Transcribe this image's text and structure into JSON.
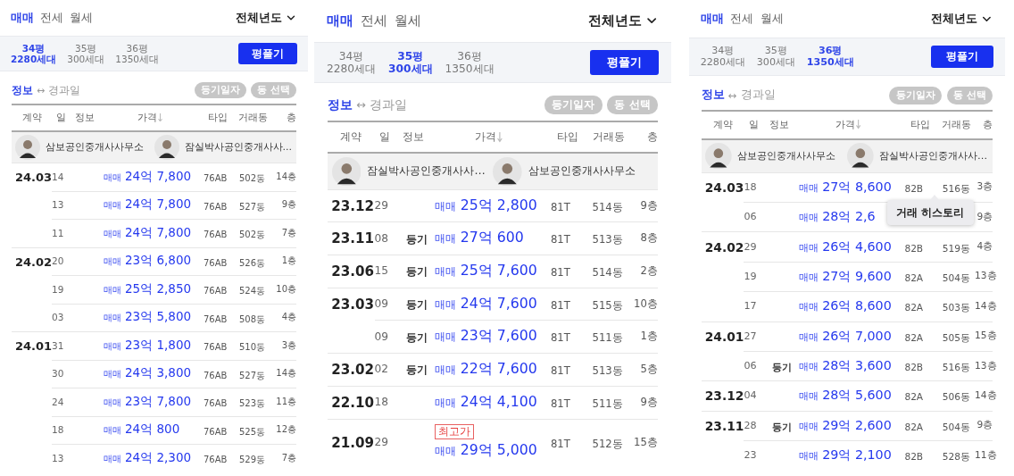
{
  "panels": [
    {
      "deal_tabs": [
        {
          "label": "매매",
          "selected": true
        },
        {
          "label": "전세",
          "selected": false
        },
        {
          "label": "월세",
          "selected": false
        }
      ],
      "year_filter": "전체년도",
      "sizes": [
        {
          "area": "34평",
          "units": "2280세대",
          "selected": true
        },
        {
          "area": "35평",
          "units": "300세대",
          "selected": false
        },
        {
          "area": "36평",
          "units": "1350세대",
          "selected": false
        }
      ],
      "size_button": "평풀기",
      "toggle": [
        {
          "label": "정보",
          "selected": true
        },
        {
          "label": "경과일",
          "selected": false
        }
      ],
      "toggle_separator": "↔",
      "chips": [
        "등기일자",
        "동 선택"
      ],
      "columns": [
        "계약",
        "일",
        "정보",
        "가격",
        "타입",
        "거래동",
        "층"
      ],
      "agents": [
        {
          "name": "삼보공인중개사사무소"
        },
        {
          "name": "잠실박사공인중개사사…"
        }
      ],
      "rows": [
        {
          "month": "24.03",
          "day": "14",
          "deal": "매매",
          "price": "24억 7,800",
          "type": "76AB",
          "dong": "502동",
          "floor": "14층"
        },
        {
          "day": "13",
          "deal": "매매",
          "price": "24억 7,800",
          "type": "76AB",
          "dong": "527동",
          "floor": "9층"
        },
        {
          "day": "11",
          "deal": "매매",
          "price": "24억 7,800",
          "type": "76AB",
          "dong": "502동",
          "floor": "7층"
        },
        {
          "month": "24.02",
          "day": "20",
          "deal": "매매",
          "price": "23억 6,800",
          "type": "76AB",
          "dong": "526동",
          "floor": "1층"
        },
        {
          "day": "19",
          "deal": "매매",
          "price": "25억 2,850",
          "type": "76AB",
          "dong": "524동",
          "floor": "10층"
        },
        {
          "day": "03",
          "deal": "매매",
          "price": "23억 5,800",
          "type": "76AB",
          "dong": "508동",
          "floor": "4층"
        },
        {
          "month": "24.01",
          "day": "31",
          "deal": "매매",
          "price": "23억 1,800",
          "type": "76AB",
          "dong": "510동",
          "floor": "3층"
        },
        {
          "day": "30",
          "deal": "매매",
          "price": "24억 3,800",
          "type": "76AB",
          "dong": "527동",
          "floor": "14층"
        },
        {
          "day": "24",
          "deal": "매매",
          "price": "23억 7,800",
          "type": "76AB",
          "dong": "523동",
          "floor": "11층"
        },
        {
          "day": "18",
          "deal": "매매",
          "price": "24억 800",
          "type": "76AB",
          "dong": "525동",
          "floor": "12층"
        },
        {
          "day": "13",
          "deal": "매매",
          "price": "24억 2,300",
          "type": "76AB",
          "dong": "529동",
          "floor": "7층"
        }
      ]
    },
    {
      "deal_tabs": [
        {
          "label": "매매",
          "selected": true
        },
        {
          "label": "전세",
          "selected": false
        },
        {
          "label": "월세",
          "selected": false
        }
      ],
      "year_filter": "전체년도",
      "sizes": [
        {
          "area": "34평",
          "units": "2280세대",
          "selected": false
        },
        {
          "area": "35평",
          "units": "300세대",
          "selected": true
        },
        {
          "area": "36평",
          "units": "1350세대",
          "selected": false
        }
      ],
      "size_button": "평풀기",
      "toggle": [
        {
          "label": "정보",
          "selected": true
        },
        {
          "label": "경과일",
          "selected": false
        }
      ],
      "toggle_separator": "↔",
      "chips": [
        "등기일자",
        "동 선택"
      ],
      "columns": [
        "계약",
        "일",
        "정보",
        "가격",
        "타입",
        "거래동",
        "층"
      ],
      "agents": [
        {
          "name": "잠실박사공인중개사사…"
        },
        {
          "name": "삼보공인중개사사무소"
        }
      ],
      "rows": [
        {
          "month": "23.12",
          "day": "29",
          "deal": "매매",
          "price": "25억 2,800",
          "type": "81T",
          "dong": "514동",
          "floor": "9층"
        },
        {
          "month": "23.11",
          "day": "08",
          "info": "등기",
          "deal": "매매",
          "price": "27억 600",
          "type": "81T",
          "dong": "513동",
          "floor": "8층"
        },
        {
          "month": "23.06",
          "day": "15",
          "info": "등기",
          "deal": "매매",
          "price": "25억 7,600",
          "type": "81T",
          "dong": "514동",
          "floor": "2층"
        },
        {
          "month": "23.03",
          "day": "09",
          "info": "등기",
          "deal": "매매",
          "price": "24억 7,600",
          "type": "81T",
          "dong": "515동",
          "floor": "10층"
        },
        {
          "day": "09",
          "info": "등기",
          "deal": "매매",
          "price": "23억 7,600",
          "type": "81T",
          "dong": "511동",
          "floor": "1층"
        },
        {
          "month": "23.02",
          "day": "02",
          "info": "등기",
          "deal": "매매",
          "price": "22억 7,600",
          "type": "81T",
          "dong": "513동",
          "floor": "5층"
        },
        {
          "month": "22.10",
          "day": "18",
          "deal": "매매",
          "price": "24억 4,100",
          "type": "81T",
          "dong": "511동",
          "floor": "9층"
        },
        {
          "month": "21.09",
          "day": "29",
          "badge": "최고가",
          "deal": "매매",
          "price": "29억 5,000",
          "type": "81T",
          "dong": "512동",
          "floor": "15층"
        }
      ]
    },
    {
      "deal_tabs": [
        {
          "label": "매매",
          "selected": true
        },
        {
          "label": "전세",
          "selected": false
        },
        {
          "label": "월세",
          "selected": false
        }
      ],
      "year_filter": "전체년도",
      "sizes": [
        {
          "area": "34평",
          "units": "2280세대",
          "selected": false
        },
        {
          "area": "35평",
          "units": "300세대",
          "selected": false
        },
        {
          "area": "36평",
          "units": "1350세대",
          "selected": true
        }
      ],
      "size_button": "평풀기",
      "toggle": [
        {
          "label": "정보",
          "selected": true
        },
        {
          "label": "경과일",
          "selected": false
        }
      ],
      "toggle_separator": "↔",
      "chips": [
        "등기일자",
        "동 선택"
      ],
      "columns": [
        "계약",
        "일",
        "정보",
        "가격",
        "타입",
        "거래동",
        "층"
      ],
      "agents": [
        {
          "name": "삼보공인중개사사무소"
        },
        {
          "name": "잠실박사공인중개사사…"
        }
      ],
      "rows": [
        {
          "month": "24.03",
          "day": "18",
          "deal": "매매",
          "price": "27억 8,600",
          "type": "82B",
          "dong": "516동",
          "floor": "3층",
          "tooltip": "거래 히스토리"
        },
        {
          "day": "06",
          "deal": "매매",
          "price": "28억 2,6",
          "floor": "9층"
        },
        {
          "month": "24.02",
          "day": "29",
          "deal": "매매",
          "price": "26억 4,600",
          "type": "82B",
          "dong": "519동",
          "floor": "4층"
        },
        {
          "day": "19",
          "deal": "매매",
          "price": "27억 9,600",
          "type": "82A",
          "dong": "504동",
          "floor": "13층"
        },
        {
          "day": "17",
          "deal": "매매",
          "price": "26억 8,600",
          "type": "82A",
          "dong": "503동",
          "floor": "14층"
        },
        {
          "month": "24.01",
          "day": "27",
          "deal": "매매",
          "price": "26억 7,000",
          "type": "82A",
          "dong": "505동",
          "floor": "15층"
        },
        {
          "day": "06",
          "info": "등기",
          "deal": "매매",
          "price": "28억 3,600",
          "type": "82B",
          "dong": "516동",
          "floor": "13층"
        },
        {
          "month": "23.12",
          "day": "04",
          "deal": "매매",
          "price": "28억 5,600",
          "type": "82A",
          "dong": "506동",
          "floor": "14층"
        },
        {
          "month": "23.11",
          "day": "28",
          "info": "등기",
          "deal": "매매",
          "price": "29억 2,600",
          "type": "82A",
          "dong": "504동",
          "floor": "9층"
        },
        {
          "day": "23",
          "deal": "매매",
          "price": "29억 2,100",
          "type": "82B",
          "dong": "528동",
          "floor": "11층"
        }
      ]
    }
  ]
}
